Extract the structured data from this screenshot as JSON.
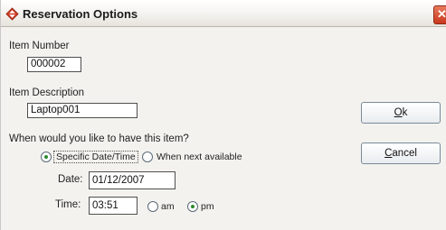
{
  "window": {
    "title": "Reservation Options",
    "close_glyph": "✕"
  },
  "item_number": {
    "label": "Item Number",
    "value": "000002"
  },
  "item_description": {
    "label": "Item Description",
    "value": "Laptop001"
  },
  "question": "When would you like to have this item?",
  "when_options": [
    {
      "label": "Specific Date/Time",
      "selected": true
    },
    {
      "label": "When next available",
      "selected": false
    }
  ],
  "date": {
    "label": "Date:",
    "value": "01/12/2007"
  },
  "time": {
    "label": "Time:",
    "value": "03:51"
  },
  "ampm_options": [
    {
      "label": "am",
      "selected": false
    },
    {
      "label": "pm",
      "selected": true
    }
  ],
  "buttons": {
    "ok": {
      "mnemonic": "O",
      "rest": "k"
    },
    "cancel": {
      "mnemonic": "C",
      "rest": "ancel"
    }
  },
  "icons": {
    "app": "diamond-arrows-icon",
    "close": "close-icon"
  },
  "colors": {
    "radio_selected": "#2b8a2b",
    "close_button": "#c8371c"
  }
}
